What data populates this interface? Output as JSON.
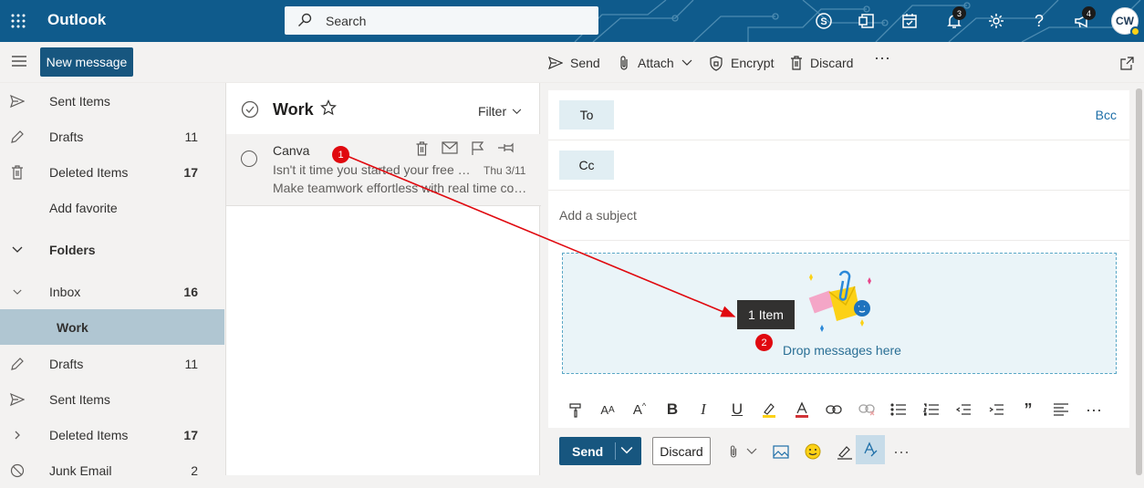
{
  "app": {
    "title": "Outlook"
  },
  "search": {
    "placeholder": "Search"
  },
  "header": {
    "notifications_count": "3",
    "whats_new_count": "4",
    "avatar_initials": "CW"
  },
  "commands": {
    "new_message": "New message",
    "send": "Send",
    "attach": "Attach",
    "encrypt": "Encrypt",
    "discard": "Discard"
  },
  "nav": {
    "favorites": [
      {
        "label": "Sent Items",
        "count": ""
      },
      {
        "label": "Drafts",
        "count": "11"
      },
      {
        "label": "Deleted Items",
        "count": "17"
      },
      {
        "label": "Add favorite",
        "count": ""
      }
    ],
    "folders_label": "Folders",
    "folders": [
      {
        "label": "Inbox",
        "count": "16"
      },
      {
        "label": "Work",
        "count": ""
      },
      {
        "label": "Drafts",
        "count": "11"
      },
      {
        "label": "Sent Items",
        "count": ""
      },
      {
        "label": "Deleted Items",
        "count": "17"
      },
      {
        "label": "Junk Email",
        "count": "2"
      }
    ]
  },
  "list": {
    "folder_name": "Work",
    "filter_label": "Filter",
    "messages": [
      {
        "sender": "Canva",
        "subject": "Isn't it time you started your free trial?",
        "date": "Thu 3/11",
        "preview": "Make teamwork effortless with real time collaboration"
      }
    ]
  },
  "compose": {
    "to_label": "To",
    "cc_label": "Cc",
    "bcc_label": "Bcc",
    "subject_placeholder": "Add a subject",
    "drop_text": "Drop messages here",
    "drag_tooltip": "1 Item",
    "send_label": "Send",
    "discard_label": "Discard"
  },
  "annotations": {
    "marker_1": "1",
    "marker_2": "2",
    "color": "#e0090f"
  },
  "colors": {
    "brand": "#0f5b8c",
    "primary_button": "#17567f",
    "selected_folder": "#b0c6d2"
  }
}
